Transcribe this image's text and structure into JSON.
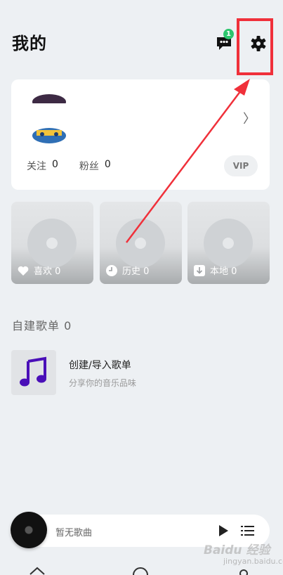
{
  "header": {
    "title": "我的",
    "message_badge": "1",
    "message_icon": "chat-bubble-icon",
    "settings_icon": "gear-icon",
    "highlight_color": "#f0303a"
  },
  "profile": {
    "chevron": "〉",
    "follow_label": "关注",
    "follow_count": "0",
    "fans_label": "粉丝",
    "fans_count": "0",
    "vip_label": "VIP"
  },
  "tiles": [
    {
      "label": "喜欢 0",
      "icon": "heart-icon"
    },
    {
      "label": "历史 0",
      "icon": "clock-icon"
    },
    {
      "label": "本地 0",
      "icon": "download-icon"
    }
  ],
  "playlists": {
    "section_title": "自建歌单 0",
    "items": [
      {
        "name": "创建/导入歌单",
        "subtitle": "分享你的音乐品味",
        "icon": "music-note-icon",
        "icon_color": "#4a0fb8"
      }
    ]
  },
  "player": {
    "status": "暂无歌曲",
    "play_icon": "play-icon",
    "queue_icon": "queue-list-icon"
  },
  "nav": {
    "items": [
      {
        "icon": "home-icon"
      },
      {
        "icon": "circle-icon"
      },
      {
        "icon": "profile-icon"
      }
    ]
  },
  "watermark": {
    "brand": "Baidu 经验",
    "sub": "jingyan.baidu.com"
  },
  "annotation": {
    "arrow_color": "#f0303a"
  }
}
